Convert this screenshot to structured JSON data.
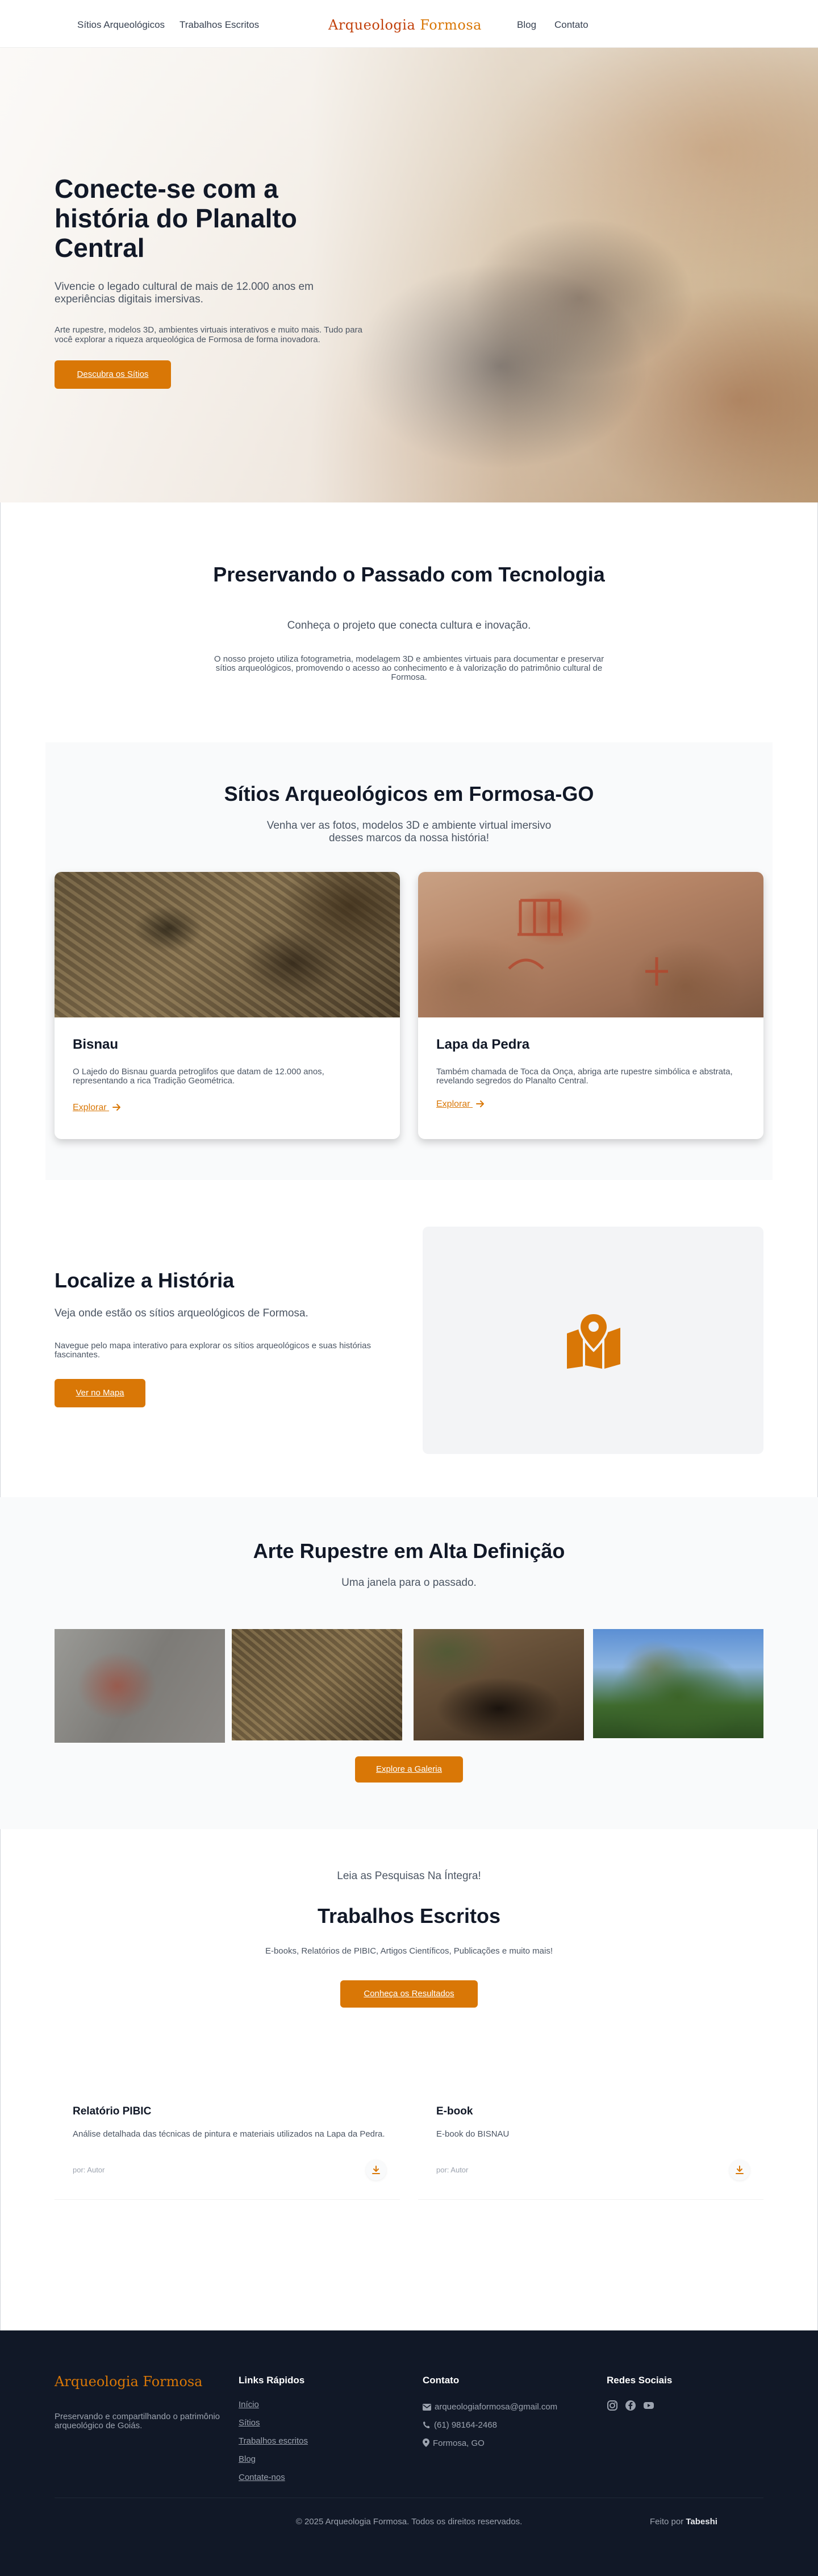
{
  "nav": {
    "links_left": [
      "Sítios Arqueológicos",
      "Trabalhos Escritos"
    ],
    "logo_part1": "Arqueologia",
    "logo_part2": "Formosa",
    "links_right": [
      "Blog",
      "Contato"
    ]
  },
  "hero": {
    "title": "Conecte-se com a história do Planalto Central",
    "subtitle": "Vivencie o legado cultural de mais de 12.000 anos em experiências digitais imersivas.",
    "text": "Arte rupestre, modelos 3D, ambientes virtuais interativos e muito mais. Tudo para você explorar a riqueza arqueológica de Formosa de forma inovadora.",
    "cta": "Descubra os Sítios"
  },
  "mission": {
    "title": "Preservando o Passado com Tecnologia",
    "subtitle": "Conheça o projeto que conecta cultura e inovação.",
    "text": "O nosso projeto utiliza fotogrametria, modelagem 3D e ambientes virtuais para documentar e preservar sítios arqueológicos, promovendo o acesso ao conhecimento e à valorização do patrimônio cultural de Formosa."
  },
  "sites": {
    "title": "Sítios Arqueológicos em Formosa-GO",
    "subtitle": "Venha ver as fotos, modelos 3D e ambiente virtual imersivo desses marcos da nossa história!",
    "cards": [
      {
        "name": "Bisnau",
        "desc": "O Lajedo do Bisnau guarda petroglifos que datam de 12.000 anos, representando a rica Tradição Geométrica.",
        "link": "Explorar"
      },
      {
        "name": "Lapa da Pedra",
        "desc": "Também chamada de Toca da Onça, abriga arte rupestre simbólica e abstrata, revelando segredos do Planalto Central.",
        "link": "Explorar"
      }
    ]
  },
  "map": {
    "title": "Localize a História",
    "subtitle": "Veja onde estão os sítios arqueológicos de Formosa.",
    "text": "Navegue pelo mapa interativo para explorar os sítios arqueológicos e suas histórias fascinantes.",
    "cta": "Ver no Mapa",
    "icon": "map-pin-icon",
    "accent": "#d97706"
  },
  "gallery": {
    "title": "Arte Rupestre em Alta Definição",
    "subtitle": "Uma janela para o passado.",
    "cta": "Explore a Galeria"
  },
  "writings": {
    "eyebrow": "Leia as Pesquisas Na Íntegra!",
    "title": "Trabalhos Escritos",
    "subtitle": "E-books, Relatórios de PIBIC, Artigos Científicos, Publicações e muito mais!",
    "cta": "Conheça os Resultados",
    "items": [
      {
        "title": "Relatório PIBIC",
        "desc": "Análise detalhada das técnicas de pintura e materiais utilizados na Lapa da Pedra.",
        "author": "por: Autor"
      },
      {
        "title": "E-book",
        "desc": "E-book do BISNAU",
        "author": "por: Autor"
      }
    ]
  },
  "footer": {
    "brand": "Arqueologia Formosa",
    "brand_desc": "Preservando e compartilhando o patrimônio arqueológico de Goiás.",
    "quick_title": "Links Rápidos",
    "quick_links": [
      "Início",
      "Sítios",
      "Trabalhos escritos",
      "Blog",
      "Contate-nos"
    ],
    "contact_title": "Contato",
    "email": "arqueologiaformosa@gmail.com",
    "phone": "(61) 98164-2468",
    "location": "Formosa, GO",
    "social_title": "Redes Sociais",
    "social_icons": [
      "instagram-icon",
      "facebook-icon",
      "youtube-icon"
    ],
    "copyright": "© 2025 Arqueologia Formosa. Todos os direitos reservados.",
    "credit_prefix": "Feito por",
    "credit_name": "Tabeshi"
  }
}
